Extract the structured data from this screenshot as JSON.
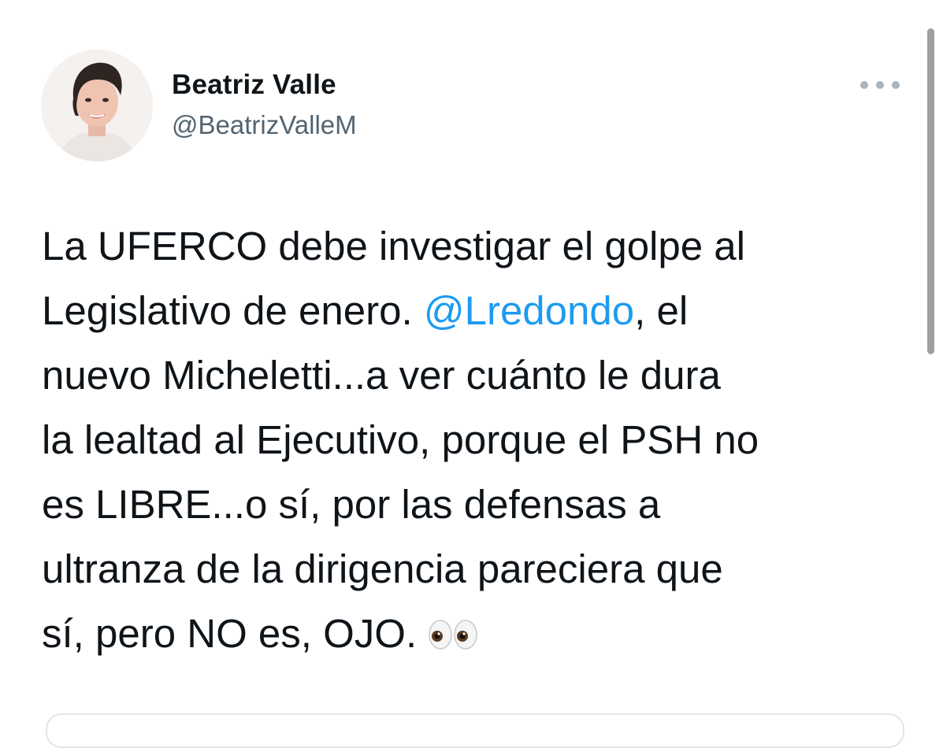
{
  "author": {
    "display_name": "Beatriz Valle",
    "handle": "@BeatrizValleM",
    "avatar": "profile-photo"
  },
  "tweet": {
    "lines": [
      [
        "La UFERCO debe investigar el golpe al"
      ],
      [
        "Legislativo de enero. ",
        "@Lredondo",
        ", el"
      ],
      [
        "nuevo Micheletti...a ver cuánto le dura"
      ],
      [
        "la lealtad al Ejecutivo, porque el PSH no"
      ],
      [
        "es LIBRE...o sí, por las defensas a"
      ],
      [
        "ultranza de la dirigencia pareciera que"
      ],
      [
        "sí, pero NO es, OJO."
      ]
    ],
    "mention": "@Lredondo",
    "emoji": "eyes-emoji"
  },
  "icons": {
    "more": "more-horizontal-icon"
  },
  "colors": {
    "text": "#0f1419",
    "secondary_text": "#536471",
    "link": "#1d9bf0",
    "background": "#ffffff"
  }
}
